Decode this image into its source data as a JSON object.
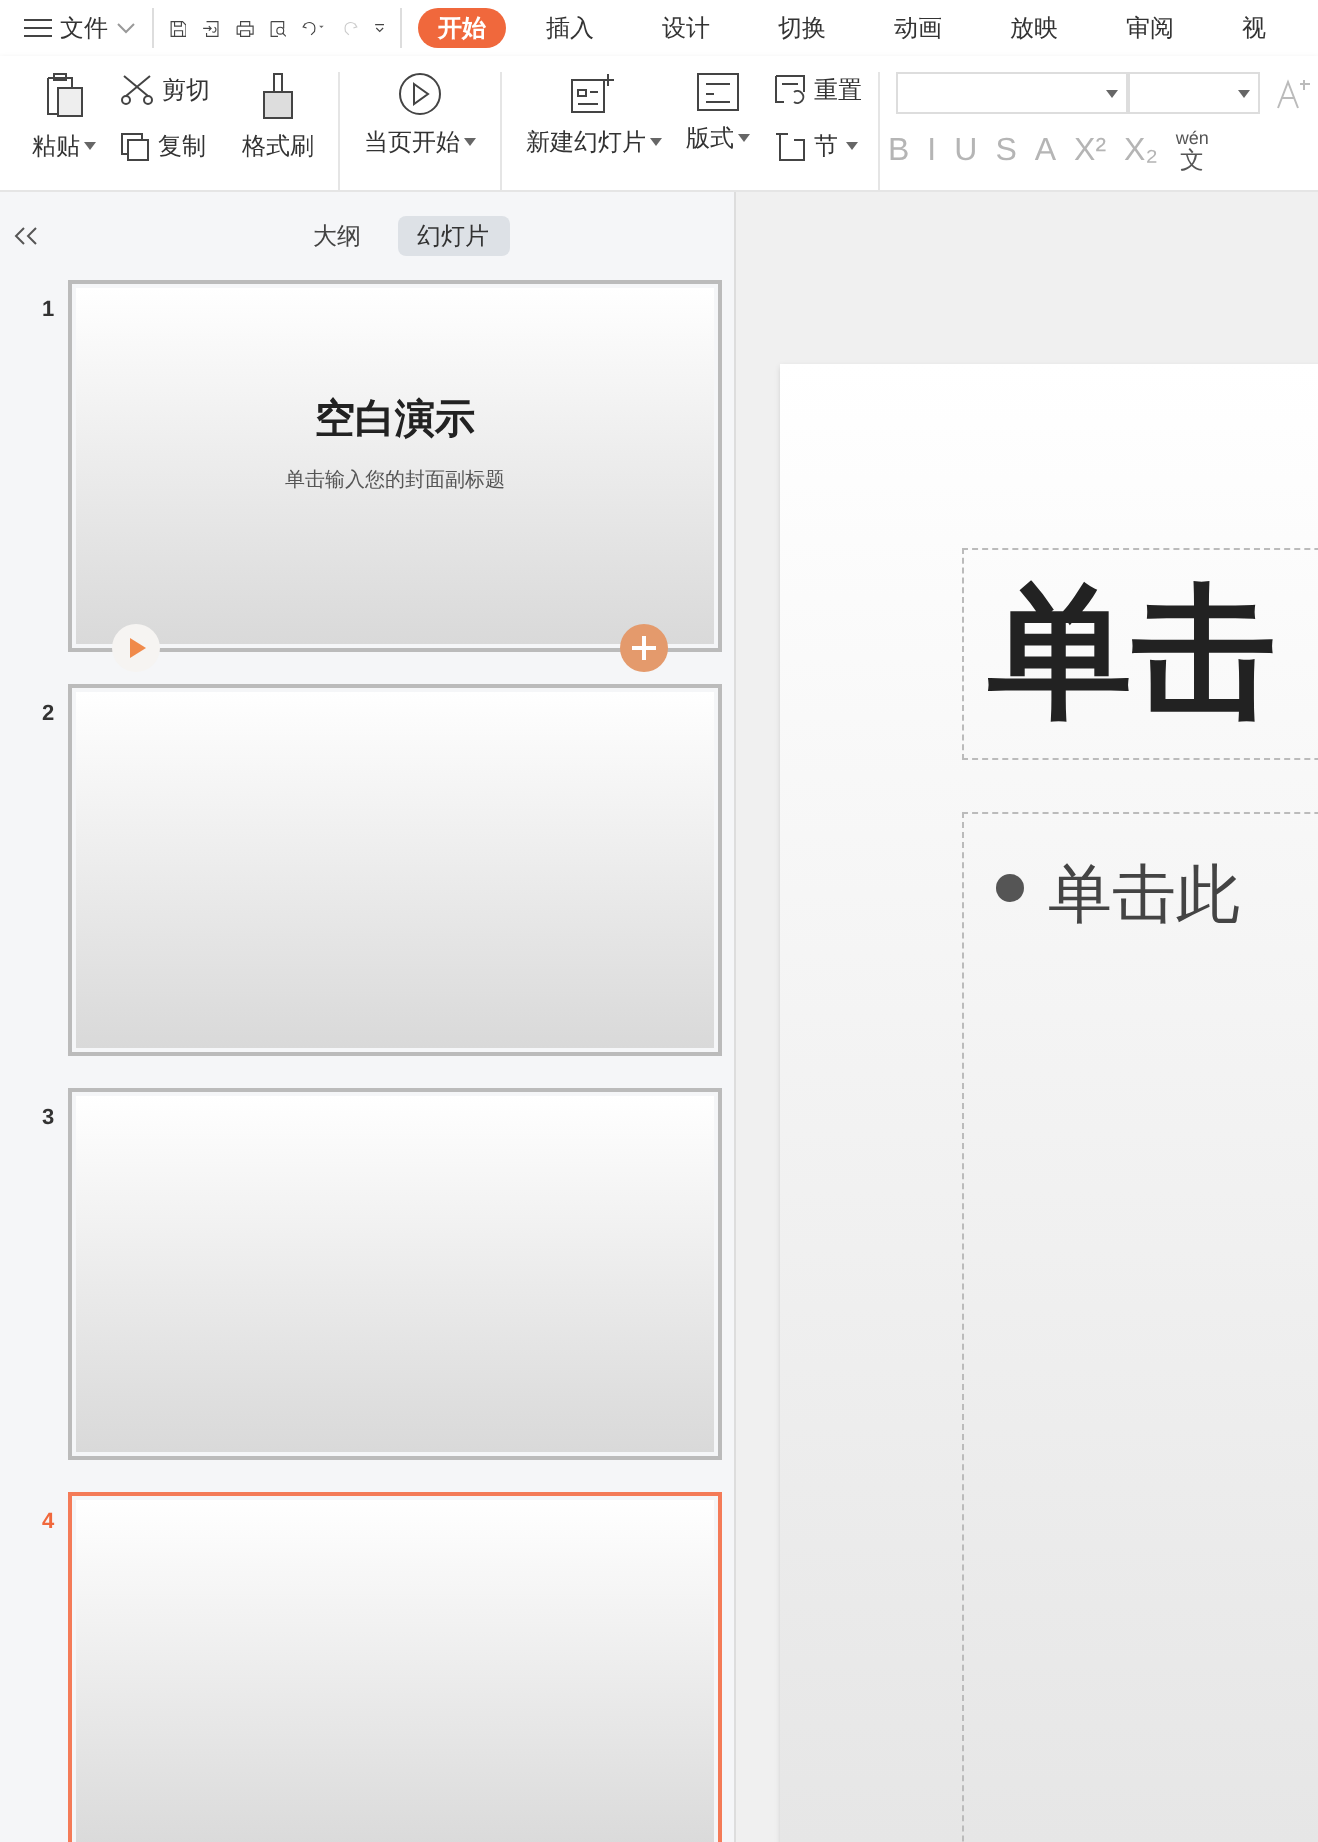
{
  "file_menu": {
    "label": "文件"
  },
  "tabs": [
    {
      "label": "开始",
      "selected": true
    },
    {
      "label": "插入",
      "selected": false
    },
    {
      "label": "设计",
      "selected": false
    },
    {
      "label": "切换",
      "selected": false
    },
    {
      "label": "动画",
      "selected": false
    },
    {
      "label": "放映",
      "selected": false
    },
    {
      "label": "审阅",
      "selected": false
    },
    {
      "label": "视",
      "selected": false
    }
  ],
  "ribbon": {
    "paste": "粘贴",
    "cut": "剪切",
    "copy": "复制",
    "format_painter": "格式刷",
    "play_from_current": "当页开始",
    "new_slide": "新建幻灯片",
    "layout": "版式",
    "reset": "重置",
    "section": "节"
  },
  "font_controls": {
    "disabled": true,
    "format_buttons": [
      "B",
      "I",
      "U",
      "S",
      "A",
      "X²",
      "X₂"
    ],
    "phonetic_ruby": "wén",
    "phonetic_glyph": "文"
  },
  "panel_tabs": [
    {
      "label": "大纲",
      "selected": false
    },
    {
      "label": "幻灯片",
      "selected": true
    }
  ],
  "slides": [
    {
      "number": "1",
      "selected": false,
      "title": "空白演示",
      "subtitle": "单击输入您的封面副标题"
    },
    {
      "number": "2",
      "selected": false
    },
    {
      "number": "3",
      "selected": false
    },
    {
      "number": "4",
      "selected": true
    }
  ],
  "editor": {
    "title": "单击",
    "body": "单击此"
  }
}
